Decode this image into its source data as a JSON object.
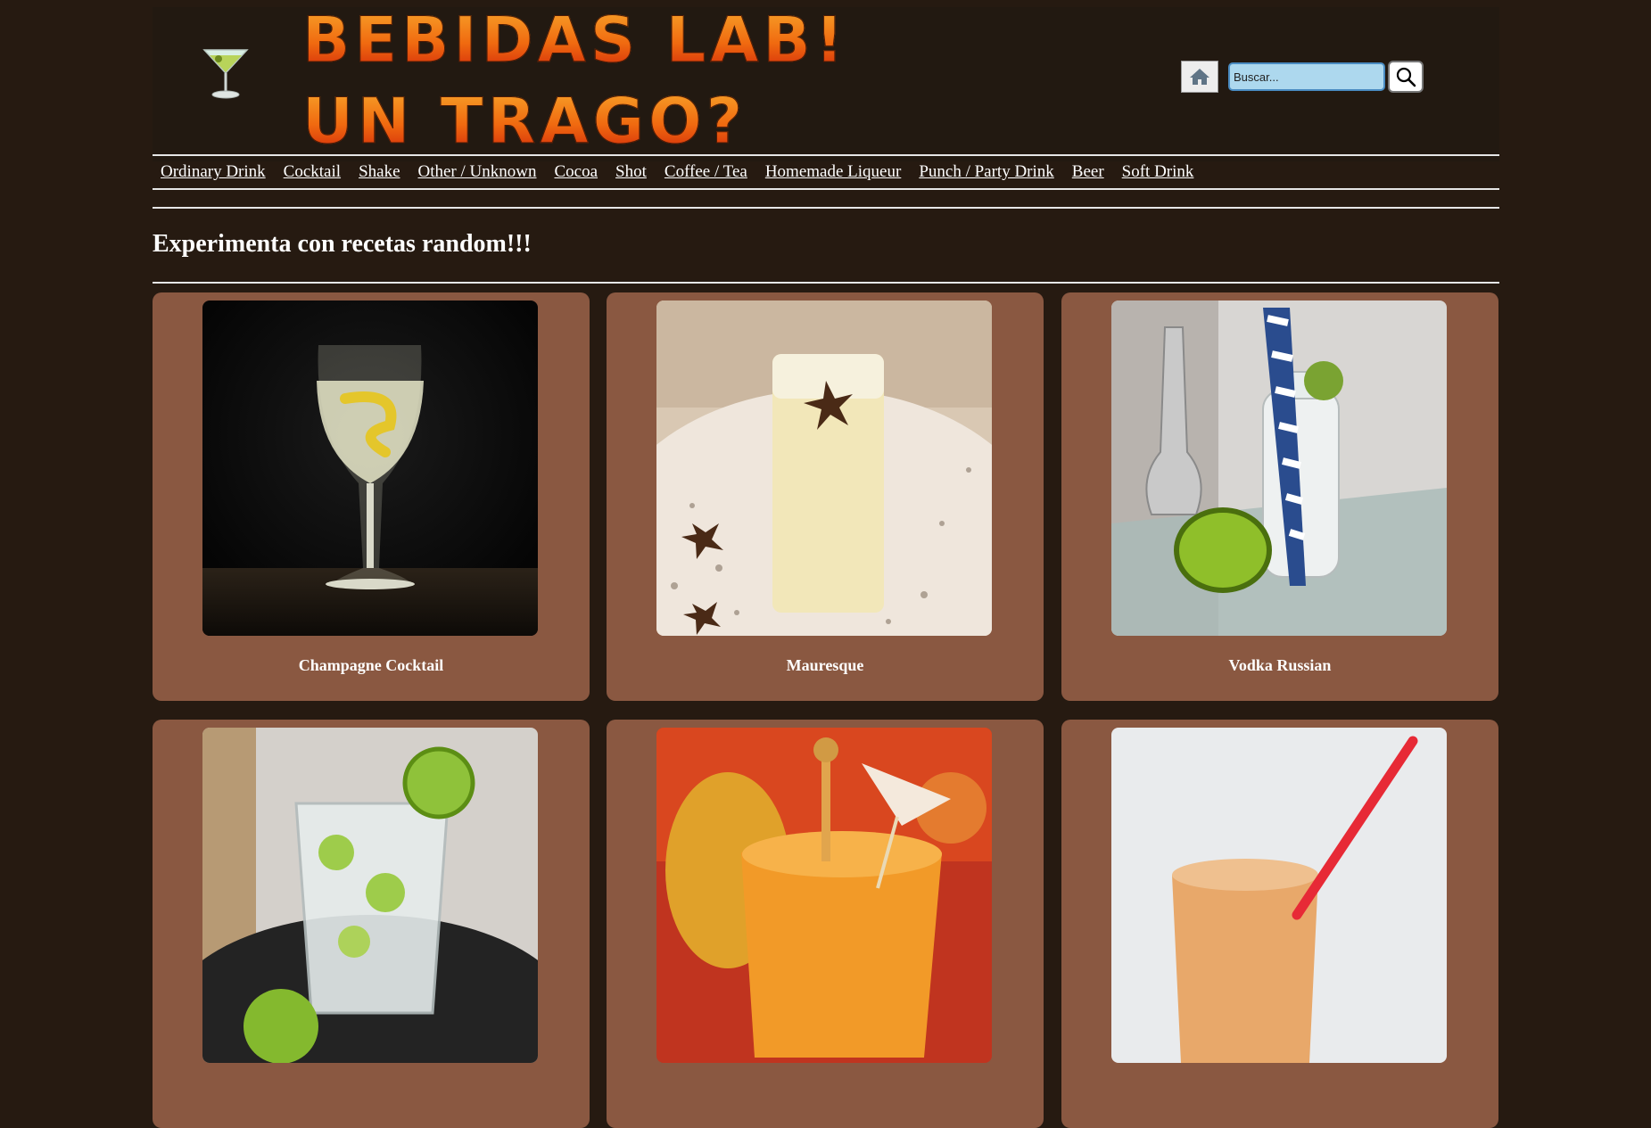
{
  "header": {
    "title_line1": "BEBIDAS LAB!",
    "title_line2": "UN TRAGO?",
    "logo_icon": "martini-icon",
    "home_icon": "home-icon",
    "search_placeholder": "Buscar...",
    "search_icon": "magnifier-icon"
  },
  "nav": {
    "items": [
      "Ordinary Drink",
      "Cocktail",
      "Shake",
      "Other / Unknown",
      "Cocoa",
      "Shot",
      "Coffee / Tea",
      "Homemade Liqueur",
      "Punch / Party Drink",
      "Beer",
      "Soft Drink"
    ]
  },
  "main": {
    "heading": "Experimenta con recetas random!!!",
    "cards": [
      {
        "name": "Champagne Cocktail"
      },
      {
        "name": "Mauresque"
      },
      {
        "name": "Vodka Russian"
      },
      {
        "name": ""
      },
      {
        "name": ""
      },
      {
        "name": ""
      }
    ]
  },
  "colors": {
    "background": "#261a11",
    "card": "#8a5841",
    "search_bg": "#add8ee"
  }
}
